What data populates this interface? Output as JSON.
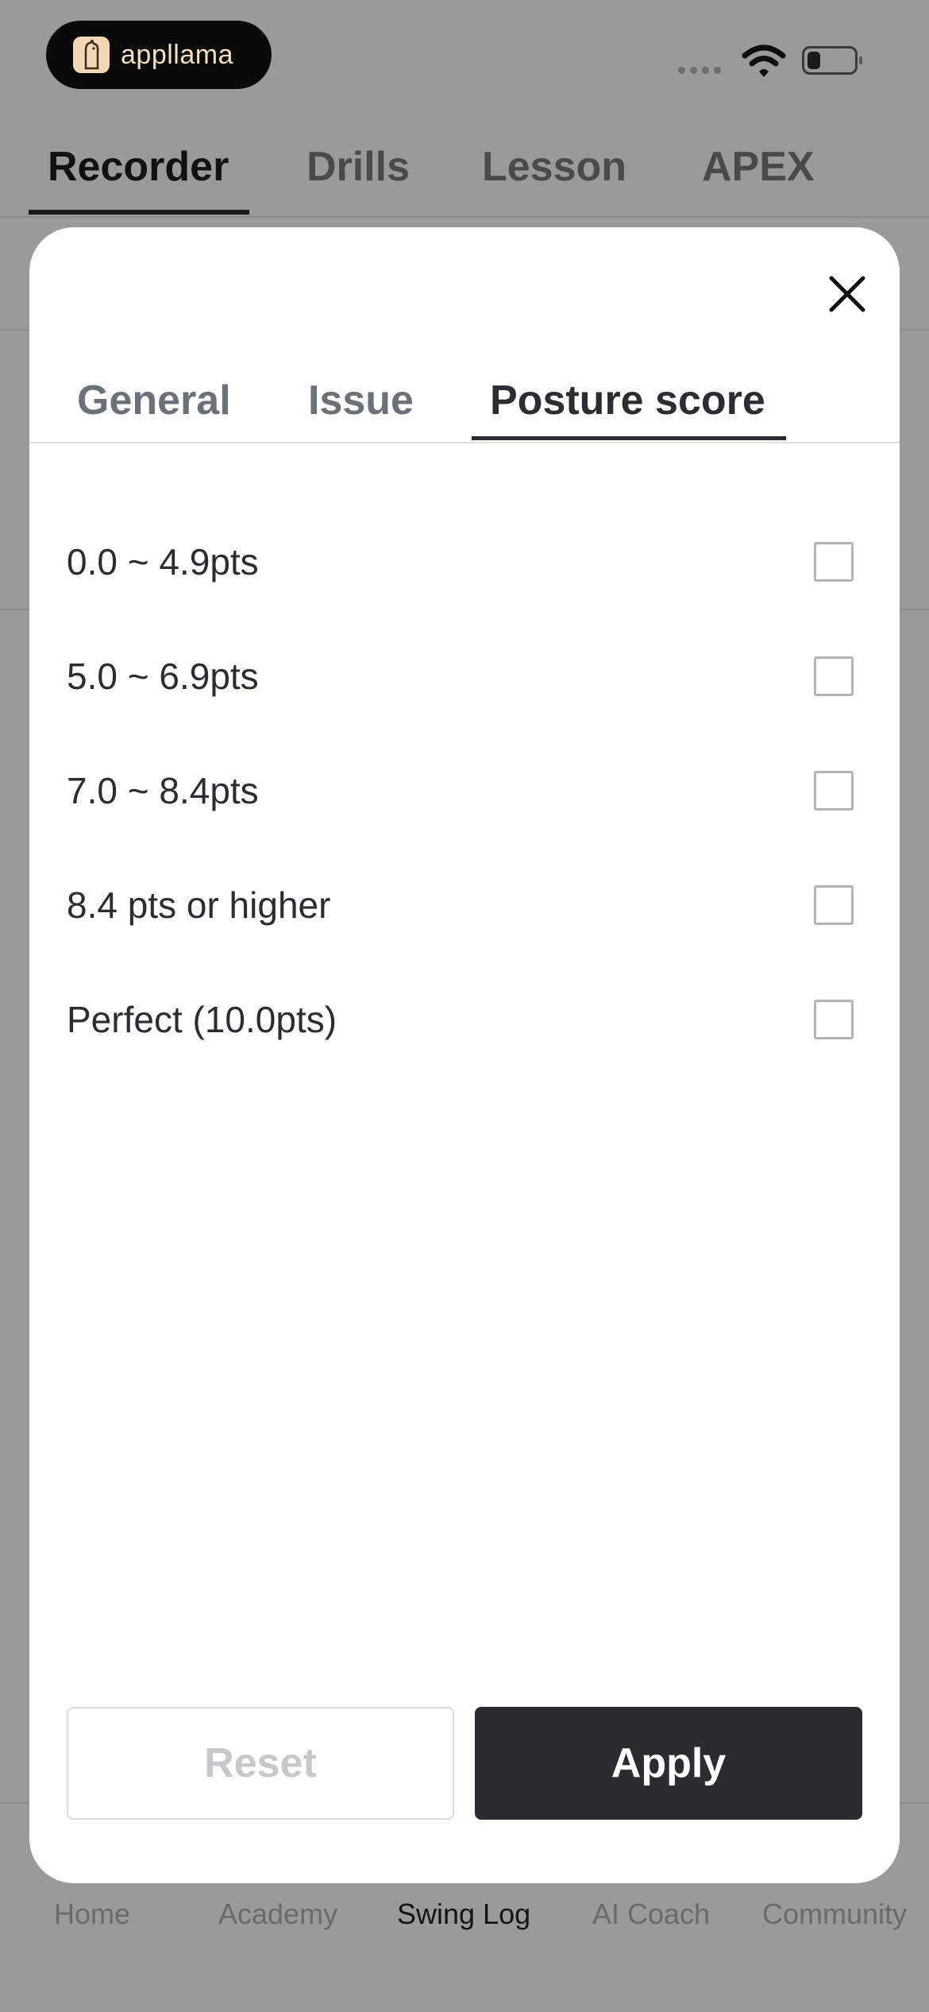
{
  "status_bar": {
    "brand_name": "appllama",
    "icons": [
      "llama-logo-icon",
      "signal-icon",
      "wifi-icon",
      "battery-icon"
    ]
  },
  "top_tabs": {
    "items": [
      {
        "label": "Recorder",
        "active": true
      },
      {
        "label": "Drills",
        "active": false
      },
      {
        "label": "Lesson",
        "active": false
      },
      {
        "label": "APEX",
        "active": false
      }
    ]
  },
  "bottom_nav": {
    "items": [
      {
        "label": "Home",
        "active": false
      },
      {
        "label": "Academy",
        "active": false
      },
      {
        "label": "Swing Log",
        "active": true
      },
      {
        "label": "AI Coach",
        "active": false
      },
      {
        "label": "Community",
        "active": false
      }
    ]
  },
  "modal": {
    "close_icon": "close-icon",
    "tabs": [
      {
        "label": "General",
        "active": false
      },
      {
        "label": "Issue",
        "active": false
      },
      {
        "label": "Posture score",
        "active": true
      }
    ],
    "options": [
      {
        "label": "0.0 ~ 4.9pts",
        "checked": false
      },
      {
        "label": "5.0 ~ 6.9pts",
        "checked": false
      },
      {
        "label": "7.0 ~ 8.4pts",
        "checked": false
      },
      {
        "label": "8.4 pts or higher",
        "checked": false
      },
      {
        "label": "Perfect (10.0pts)",
        "checked": false
      }
    ],
    "reset_label": "Reset",
    "apply_label": "Apply"
  },
  "colors": {
    "overlay": "#9a9a9a",
    "primary_dark": "#2a2c31",
    "tab_inactive": "#6b7079",
    "disabled_text": "#c6c8cc"
  }
}
